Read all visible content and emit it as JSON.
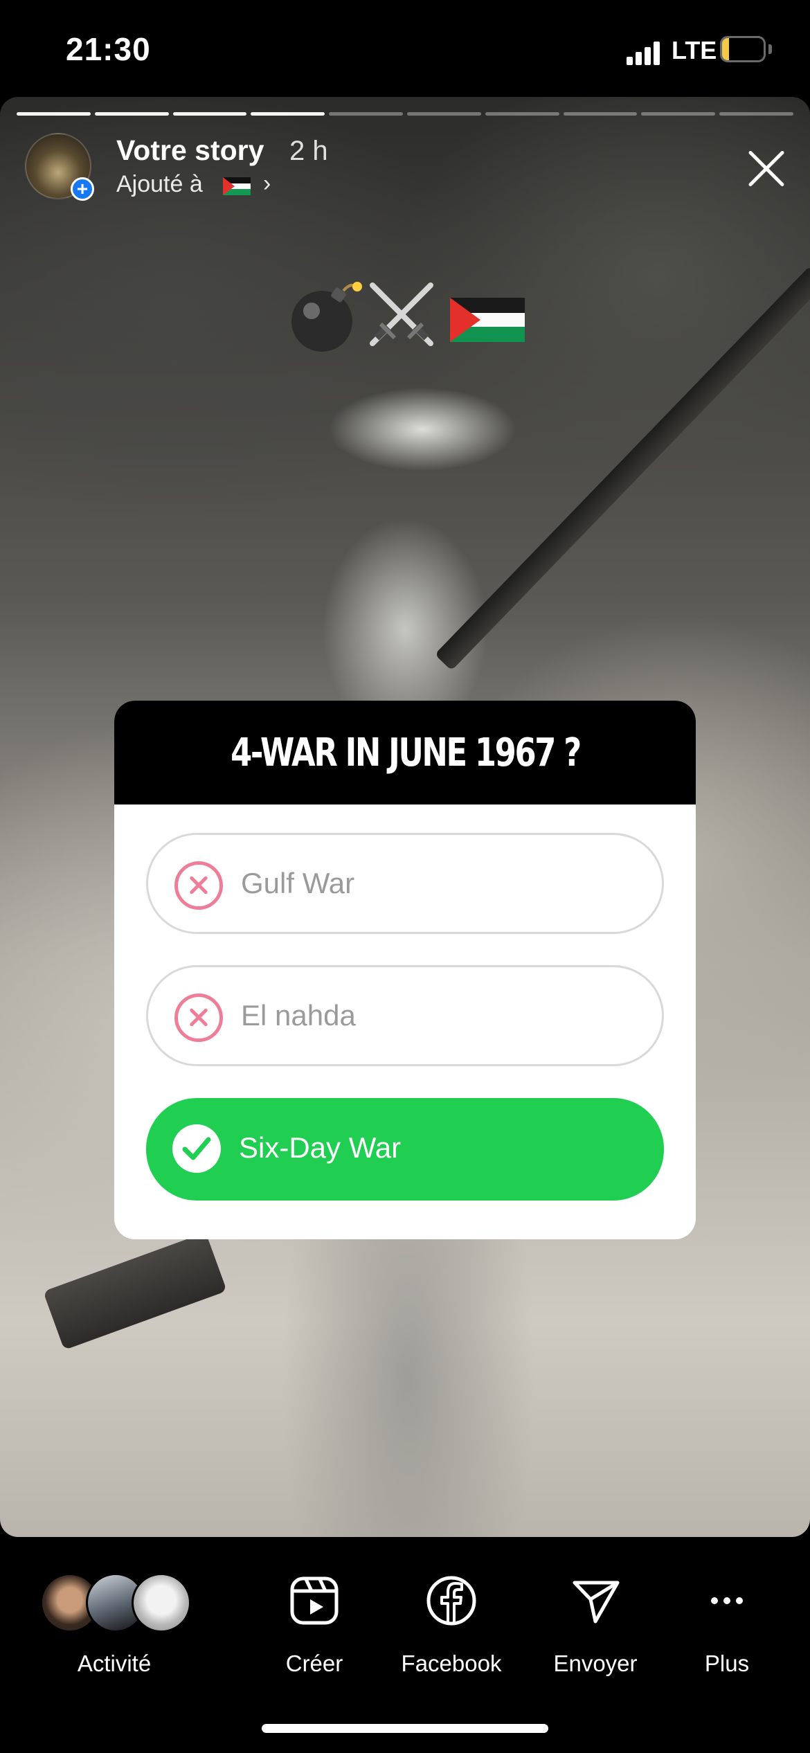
{
  "status_bar": {
    "time": "21:30",
    "network": "LTE",
    "battery": "16",
    "battery_level": 0.16
  },
  "story_header": {
    "title": "Votre story",
    "time_ago": "2 h",
    "added_to": "Ajouté à",
    "icons": [
      "avatar",
      "add-plus-icon",
      "palestine-flag-icon",
      "chevron-right-icon",
      "close-icon"
    ]
  },
  "progress": {
    "segments": 10,
    "completed": 4
  },
  "stickers": {
    "emojis": [
      "bomb-emoji",
      "crossed-swords-emoji",
      "palestine-flag-emoji"
    ]
  },
  "quiz": {
    "question": "4-WAR IN JUNE 1967 ?",
    "options": [
      {
        "label": "Gulf War",
        "state": "wrong"
      },
      {
        "label": "El nahda",
        "state": "wrong"
      },
      {
        "label": "Six-Day War",
        "state": "correct"
      }
    ],
    "colors": {
      "correct": "#20ce52",
      "wrong": "#ee7e98",
      "header": "#000000"
    }
  },
  "bottom_bar": {
    "activity_label": "Activité",
    "create_label": "Créer",
    "facebook_label": "Facebook",
    "send_label": "Envoyer",
    "more_label": "Plus"
  }
}
